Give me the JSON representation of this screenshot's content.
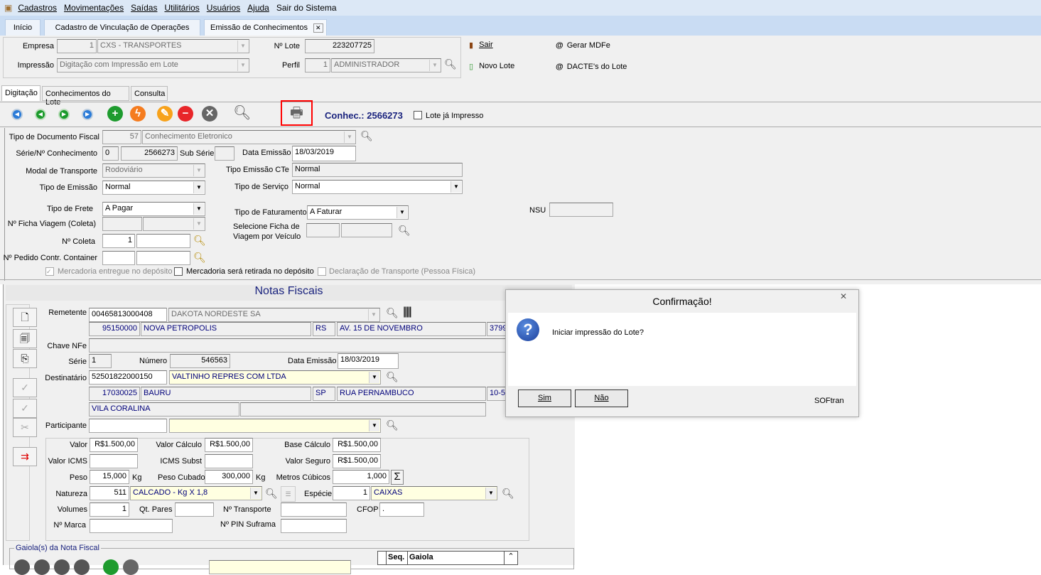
{
  "menu": [
    "Cadastros",
    "Movimentações",
    "Saídas",
    "Utilitários",
    "Usuários",
    "Ajuda",
    "Sair do Sistema"
  ],
  "tabs": [
    "Início",
    "Cadastro de Vinculação de Operações",
    "Emissão de Conhecimentos"
  ],
  "header": {
    "empresa_label": "Empresa",
    "empresa_code": "1",
    "empresa_name": "CXS - TRANSPORTES",
    "impressao_label": "Impressão",
    "impressao_value": "Digitação com Impressão em Lote",
    "lote_label": "Nº Lote",
    "lote_value": "223207725",
    "perfil_label": "Perfil",
    "perfil_code": "1",
    "perfil_name": "ADMINISTRADOR",
    "sair": "Sair",
    "novo_lote": "Novo Lote",
    "gerar_mdfe": "Gerar MDFe",
    "dacte_lote": "DACTE's do Lote"
  },
  "subtabs": [
    "Digitação",
    "Conhecimentos do Lote",
    "Consulta"
  ],
  "toolbar": {
    "conhec_label": "Conhec.:",
    "conhec_value": "2566273",
    "lote_impresso": "Lote já Impresso",
    "accent": "#ff0000"
  },
  "form": {
    "tipo_doc_label": "Tipo de Documento Fiscal",
    "tipo_doc_code": "57",
    "tipo_doc_name": "Conhecimento Eletronico",
    "serie_label": "Série/Nº Conhecimento",
    "serie": "0",
    "numero": "2566273",
    "sub_serie_label": "Sub Série",
    "data_emissao_label": "Data Emissão",
    "data_emissao": "18/03/2019",
    "modal_label": "Modal de Transporte",
    "modal": "Rodoviário",
    "tipo_emissao_cte_label": "Tipo Emissão CTe",
    "tipo_emissao_cte": "Normal",
    "tipo_emissao_label": "Tipo de Emissão",
    "tipo_emissao": "Normal",
    "tipo_servico_label": "Tipo de Serviço",
    "tipo_servico": "Normal",
    "tipo_frete_label": "Tipo de Frete",
    "tipo_frete": "A Pagar",
    "tipo_faturamento_label": "Tipo de Faturamento",
    "tipo_faturamento": "A Faturar",
    "nsu_label": "NSU",
    "ficha_label": "Nº Ficha Viagem (Coleta)",
    "selecione_ficha_label1": "Selecione Ficha de",
    "selecione_ficha_label2": "Viagem por Veículo",
    "coleta_label": "Nº Coleta",
    "coleta": "1",
    "pedido_label": "Nº Pedido Contr. Container",
    "chk_entregue": "Mercadoria entregue no depósito",
    "chk_retirada": "Mercadoria será retirada no depósito",
    "chk_declaracao": "Declaração de Transporte (Pessoa Física)"
  },
  "notas": {
    "title": "Notas Fiscais",
    "remetente_label": "Remetente",
    "remetente_cnpj": "00465813000408",
    "remetente_nome": "DAKOTA NORDESTE SA",
    "rem_cep": "95150000",
    "rem_cidade": "NOVA PETROPOLIS",
    "rem_uf": "RS",
    "rem_endereco": "AV. 15 DE NOVEMBRO",
    "rem_num": "3799",
    "chave_label": "Chave NFe",
    "serie_label": "Série",
    "serie": "1",
    "numero_label": "Número",
    "numero": "546563",
    "data_label": "Data Emissão",
    "data": "18/03/2019",
    "destinatario_label": "Destinatário",
    "dest_cnpj": "52501822000150",
    "dest_nome": "VALTINHO REPRES COM LTDA",
    "dest_cep": "17030025",
    "dest_cidade": "BAURU",
    "dest_uf": "SP",
    "dest_endereco": "RUA PERNAMBUCO",
    "dest_num": "10-5",
    "dest_bairro": "VILA CORALINA",
    "participante_label": "Participante",
    "valor_label": "Valor",
    "valor": "R$1.500,00",
    "valor_calculo_label": "Valor Cálculo",
    "valor_calculo": "R$1.500,00",
    "base_calculo_label": "Base Cálculo",
    "base_calculo": "R$1.500,00",
    "valor_icms_label": "Valor ICMS",
    "icms_subst_label": "ICMS Subst",
    "valor_seguro_label": "Valor Seguro",
    "valor_seguro": "R$1.500,00",
    "peso_label": "Peso",
    "peso": "15,000",
    "kg": "Kg",
    "peso_cubado_label": "Peso Cubado",
    "peso_cubado": "300,000",
    "metros_label": "Metros Cúbicos",
    "metros": "1,000",
    "sigma": "Σ",
    "natureza_label": "Natureza",
    "natureza_code": "511",
    "natureza": "CALCADO - Kg X 1,8",
    "especie_label": "Espécie",
    "especie_code": "1",
    "especie": "CAIXAS",
    "volumes_label": "Volumes",
    "volumes": "1",
    "qt_pares_label": "Qt. Pares",
    "transporte_label": "Nº Transporte",
    "cfop_label": "CFOP",
    "cfop": ".",
    "marca_label": "Nº Marca",
    "pin_label": "Nº PIN Suframa",
    "gaiola_title": "Gaiola(s) da Nota Fiscal",
    "seq_header": "Seq.",
    "gaiola_header": "Gaiola"
  },
  "dialog": {
    "title": "Confirmação!",
    "message": "Iniciar impressão do Lote?",
    "yes": "Sim",
    "no": "Não",
    "brand": "SOFtran",
    "icon": "question-icon"
  }
}
